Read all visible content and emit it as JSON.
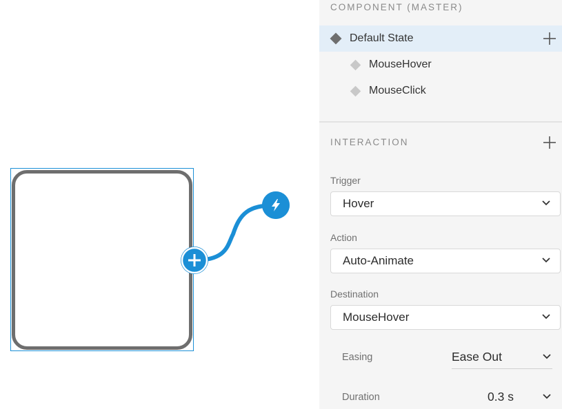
{
  "canvas": {
    "accent_color": "#1b8fd6",
    "shape_stroke_color": "#6e6e6e",
    "add_handle_icon": "plus-icon",
    "trigger_handle_icon": "lightning-bolt-icon"
  },
  "states_section": {
    "title": "COMPONENT (MASTER)",
    "states": [
      {
        "label": "Default State",
        "active": true
      },
      {
        "label": "MouseHover",
        "active": false
      },
      {
        "label": "MouseClick",
        "active": false
      }
    ]
  },
  "interaction_section": {
    "title": "INTERACTION",
    "trigger": {
      "label": "Trigger",
      "value": "Hover"
    },
    "action": {
      "label": "Action",
      "value": "Auto-Animate"
    },
    "destination": {
      "label": "Destination",
      "value": "MouseHover"
    },
    "easing": {
      "label": "Easing",
      "value": "Ease Out"
    },
    "duration": {
      "label": "Duration",
      "value": "0.3 s"
    }
  }
}
